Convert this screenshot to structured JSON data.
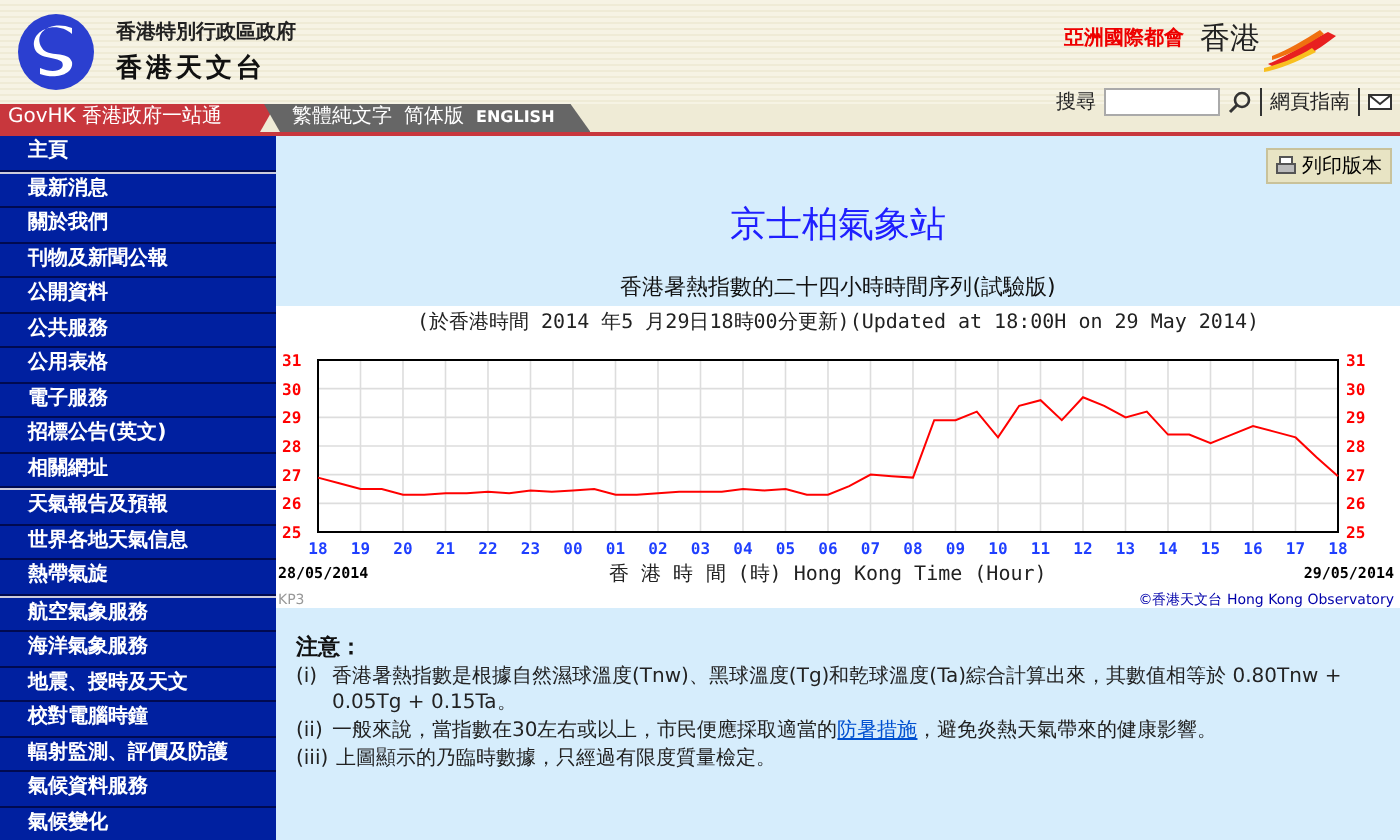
{
  "header": {
    "government": "香港特別行政區政府",
    "observatory": "香港天文台",
    "slogan": "亞洲國際都會",
    "brand": "香港"
  },
  "nav": {
    "govhk": "GovHK 香港政府一站通",
    "languages": [
      "繁體純文字",
      "简体版",
      "ENGLISH"
    ]
  },
  "search": {
    "label": "搜尋",
    "guide": "網頁指南"
  },
  "sidebar": {
    "groups": [
      [
        "主頁"
      ],
      [
        "最新消息",
        "關於我們",
        "刊物及新聞公報",
        "公開資料",
        "公共服務",
        "公用表格",
        "電子服務",
        "招標公告(英文)",
        "相關網址"
      ],
      [
        "天氣報告及預報",
        "世界各地天氣信息",
        "熱帶氣旋"
      ],
      [
        "航空氣象服務",
        "海洋氣象服務",
        "地震、授時及天文",
        "校對電腦時鐘",
        "輻射監測、評價及防護",
        "氣候資料服務",
        "氣候變化"
      ]
    ]
  },
  "print_button": "列印版本",
  "title": "京士柏氣象站",
  "subtitle": "香港暑熱指數的二十四小時時間序列(試驗版)",
  "updated": "(於香港時間 2014 年5 月29日18時00分更新)(Updated at 18:00H on 29 May 2014)",
  "chart_data": {
    "type": "line",
    "xlabel": "香 港 時 間 (時) Hong Kong Time (Hour)",
    "categories": [
      "18",
      null,
      "19",
      null,
      "20",
      null,
      "21",
      null,
      "22",
      null,
      "23",
      null,
      "00",
      null,
      "01",
      null,
      "02",
      null,
      "03",
      null,
      "04",
      null,
      "05",
      null,
      "06",
      null,
      "07",
      null,
      "08",
      null,
      "09",
      null,
      "10",
      null,
      "11",
      null,
      "12",
      null,
      "13",
      null,
      "14",
      null,
      "15",
      null,
      "16",
      null,
      "17",
      null,
      "18"
    ],
    "series": [
      {
        "color": "#ff0000",
        "values": [
          26.9,
          26.7,
          26.5,
          26.5,
          26.3,
          26.3,
          26.35,
          26.35,
          26.4,
          26.35,
          26.45,
          26.4,
          26.45,
          26.5,
          26.3,
          26.3,
          26.35,
          26.4,
          26.4,
          26.4,
          26.5,
          26.45,
          26.5,
          26.3,
          26.3,
          26.6,
          27.0,
          26.95,
          26.9,
          28.9,
          28.9,
          29.2,
          28.3,
          29.4,
          29.6,
          28.9,
          29.7,
          29.4,
          29.0,
          29.2,
          28.4,
          28.4,
          28.1,
          28.4,
          28.7,
          28.5,
          28.3,
          27.6,
          26.95
        ]
      }
    ],
    "ylim": [
      25,
      31
    ],
    "yticks": [
      25,
      26,
      27,
      28,
      29,
      30,
      31
    ],
    "grid": true
  },
  "left_axis_labels": [
    "31",
    "30",
    "29",
    "28",
    "27",
    "26",
    "25"
  ],
  "start_date": "28/05/2014",
  "end_date": "29/05/2014",
  "chart_code": "KP3",
  "copyright": "©香港天文台 Hong Kong Observatory",
  "notes": {
    "heading": "注意：",
    "items": [
      {
        "marker": "(i)",
        "text": "香港暑熱指數是根據自然濕球溫度(Tnw)、黑球溫度(Tg)和乾球溫度(Ta)綜合計算出來，其數值相等於 0.80Tnw + 0.05Tg + 0.15Ta。"
      },
      {
        "marker": "(ii)",
        "text": "一般來說，當指數在30左右或以上，市民便應採取適當的",
        "link": "防暑措施",
        "after": "，避免炎熱天氣帶來的健康影響。"
      },
      {
        "marker": "(iii)",
        "text": "上圖顯示的乃臨時數據，只經過有限度質量檢定。"
      }
    ]
  }
}
